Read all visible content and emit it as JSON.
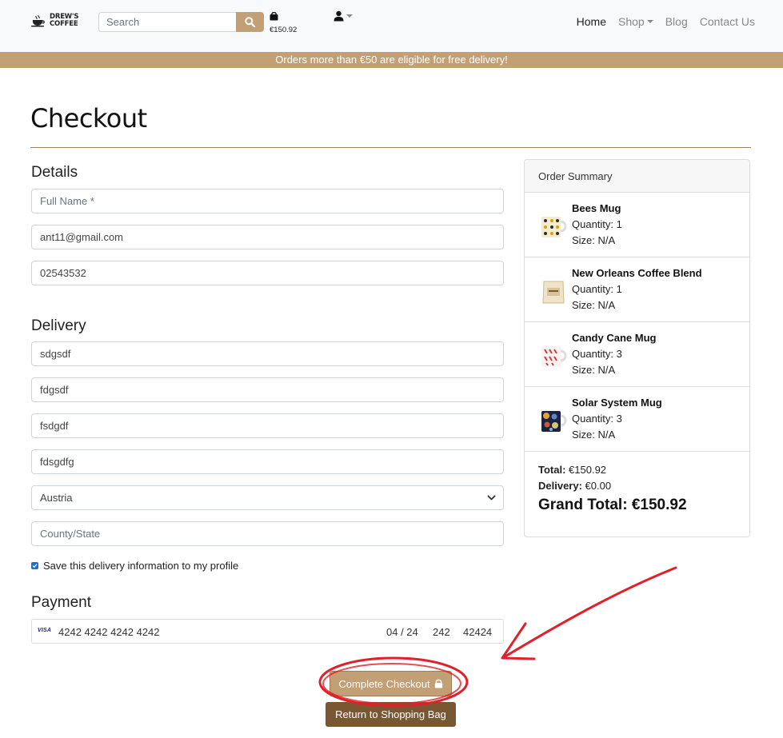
{
  "header": {
    "logo_line1": "DREW'S",
    "logo_line2": "COFFEE",
    "search_placeholder": "Search",
    "bag_total": "€150.92",
    "nav": [
      {
        "label": "Home"
      },
      {
        "label": "Shop"
      },
      {
        "label": "Blog"
      },
      {
        "label": "Contact Us"
      }
    ],
    "promo": "Orders more than €50 are eligible for free delivery!"
  },
  "page": {
    "title": "Checkout"
  },
  "details": {
    "heading": "Details",
    "full_name_placeholder": "Full Name *",
    "email": "ant11@gmail.com",
    "phone": "02543532"
  },
  "delivery": {
    "heading": "Delivery",
    "address1": "sdgsdf",
    "address2": "fdgsdf",
    "town": "fsdgdf",
    "postcode": "fdsgdfg",
    "country": "Austria",
    "county_placeholder": "County/State",
    "save_label": "Save this delivery information to my profile"
  },
  "payment": {
    "heading": "Payment",
    "brand": "VISA",
    "card_number": "4242 4242 4242 4242",
    "expiry": "04 / 24",
    "cvc": "242",
    "zip": "42424"
  },
  "summary": {
    "heading": "Order Summary",
    "items": [
      {
        "name": "Bees Mug",
        "quantity": "Quantity: 1",
        "size": "Size: N/A"
      },
      {
        "name": "New Orleans Coffee Blend",
        "quantity": "Quantity: 1",
        "size": "Size: N/A"
      },
      {
        "name": "Candy Cane Mug",
        "quantity": "Quantity: 3",
        "size": "Size: N/A"
      },
      {
        "name": "Solar System Mug",
        "quantity": "Quantity: 3",
        "size": "Size: N/A"
      }
    ],
    "total_label": "Total:",
    "total_value": "€150.92",
    "delivery_label": "Delivery:",
    "delivery_value": "€0.00",
    "grand_label": "Grand Total:",
    "grand_value": "€150.92"
  },
  "buttons": {
    "complete": "Complete Checkout",
    "return": "Return to Shopping Bag"
  },
  "colors": {
    "accent": "#c39f75",
    "dark_brown": "#7a5733",
    "annotation_red": "#e0202a"
  }
}
